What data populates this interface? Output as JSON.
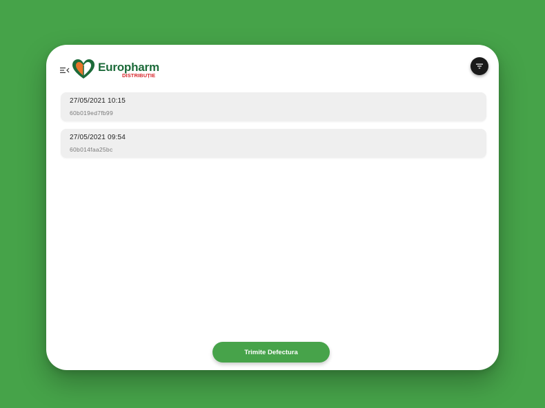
{
  "app": {
    "logo": {
      "name": "Europharm",
      "subtitle": "DISTRIBUȚIE"
    },
    "colors": {
      "background": "#46a349",
      "brand_green": "#1d6b3a",
      "brand_red": "#d7262b",
      "accent_orange": "#e8742a",
      "button_green": "#47a34a"
    },
    "icons": {
      "menu": "menu-collapse-icon",
      "filter": "filter-icon"
    }
  },
  "list": {
    "items": [
      {
        "date": "27/05/2021 10:15",
        "id": "60b019ed7fb99"
      },
      {
        "date": "27/05/2021 09:54",
        "id": "60b014faa25bc"
      }
    ]
  },
  "actions": {
    "submit_label": "Trimite Defectura"
  }
}
